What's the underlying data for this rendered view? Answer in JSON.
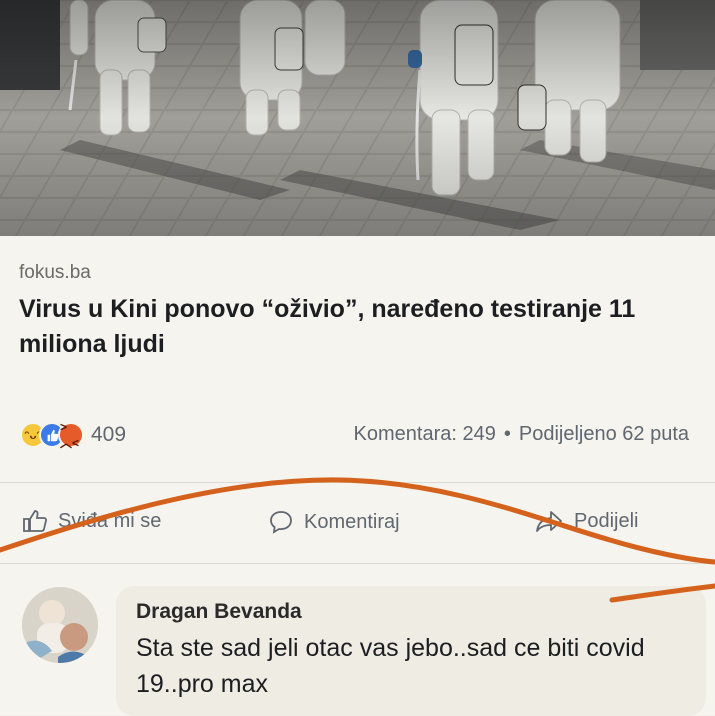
{
  "post": {
    "source": "fokus.ba",
    "headline": "Virus u Kini ponovo “oživio”, naređeno testiranje 11 miliona ljudi",
    "reactions": {
      "icons": [
        "haha-icon",
        "like-icon",
        "angry-icon"
      ],
      "count": "409"
    },
    "stats": {
      "comments": "Komentara: 249",
      "separator": "•",
      "shares": "Podijeljeno 62 puta"
    },
    "actions": {
      "like_label": "Sviđa mi se",
      "comment_label": "Komentiraj",
      "share_label": "Podijeli"
    }
  },
  "comment": {
    "author": "Dragan Bevanda",
    "text": "Sta ste sad jeli otac vas jebo..sad ce biti covid 19..pro max"
  },
  "colors": {
    "annotation_stroke": "#d4621c",
    "text_secondary": "#606770",
    "like_blue": "#3b7be8"
  }
}
